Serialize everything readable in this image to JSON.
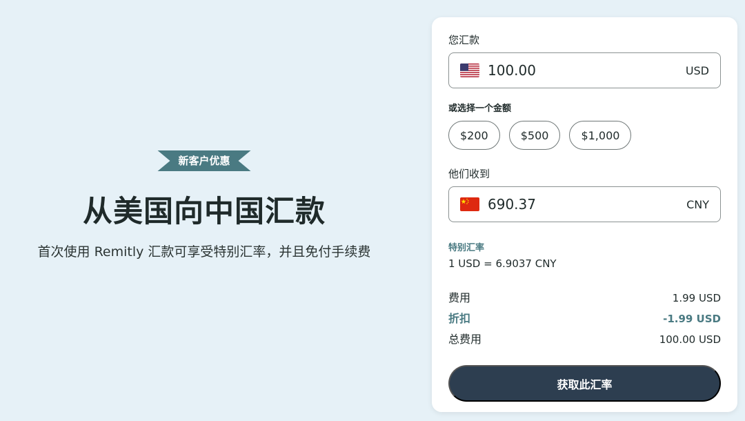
{
  "hero": {
    "badge": "新客户优惠",
    "title": "从美国向中国汇款",
    "subtitle": "首次使用 Remitly 汇款可享受特别汇率，并且免付手续费"
  },
  "send": {
    "label": "您汇款",
    "amount": "100.00",
    "currency": "USD",
    "flag_icon": "us-flag-icon"
  },
  "quick_amounts": {
    "label": "或选择一个金额",
    "options": [
      "$200",
      "$500",
      "$1,000"
    ]
  },
  "receive": {
    "label": "他们收到",
    "amount": "690.37",
    "currency": "CNY",
    "flag_icon": "china-flag-icon"
  },
  "rate": {
    "title": "特别汇率",
    "value": "1 USD = 6.9037 CNY"
  },
  "summary": {
    "fee_label": "费用",
    "fee_value": "1.99 USD",
    "discount_label": "折扣",
    "discount_value": "-1.99 USD",
    "total_label": "总费用",
    "total_value": "100.00 USD"
  },
  "cta": {
    "label": "获取此汇率"
  },
  "colors": {
    "background": "#e6f1f7",
    "accent_teal": "#4a7a82",
    "button_dark": "#2d3e50"
  }
}
